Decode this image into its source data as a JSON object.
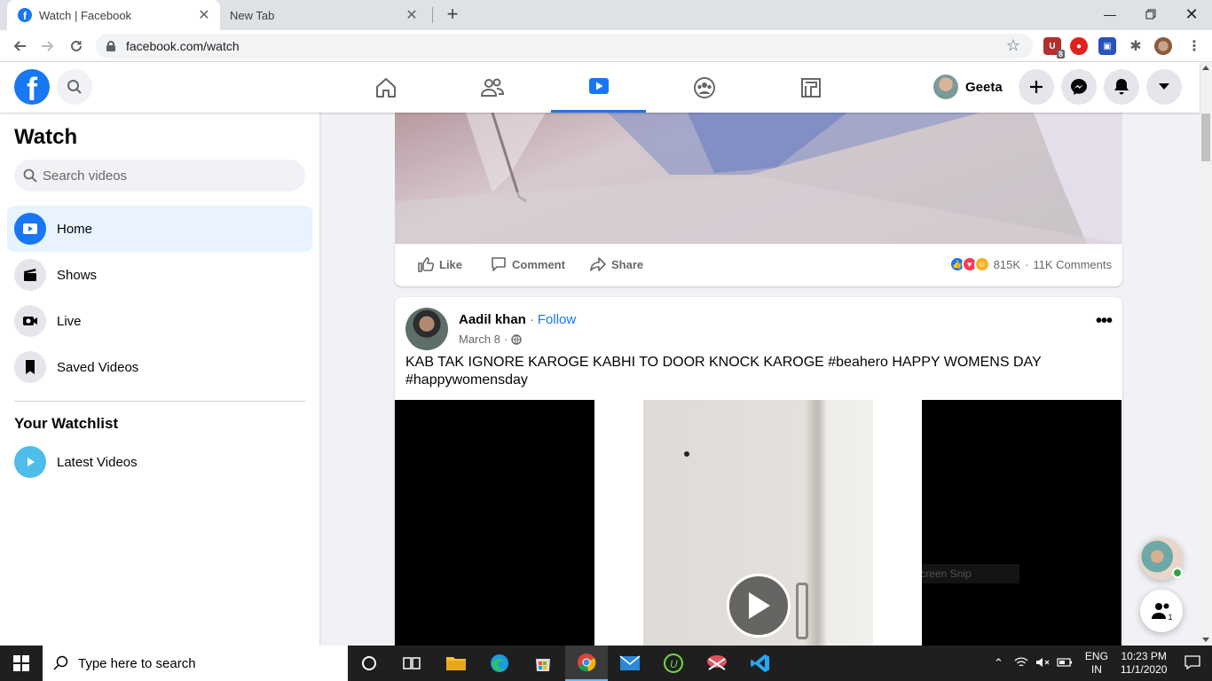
{
  "browser": {
    "tabs": [
      {
        "title": "Watch | Facebook",
        "active": true
      },
      {
        "title": "New Tab",
        "active": false
      }
    ],
    "url": "facebook.com/watch",
    "extension_badge": "8"
  },
  "header": {
    "logo_letter": "f",
    "profile_name": "Geeta"
  },
  "sidebar": {
    "title": "Watch",
    "search_placeholder": "Search videos",
    "items": [
      {
        "label": "Home",
        "icon": "play-icon"
      },
      {
        "label": "Shows",
        "icon": "clapperboard-icon"
      },
      {
        "label": "Live",
        "icon": "live-camera-icon"
      },
      {
        "label": "Saved Videos",
        "icon": "bookmark-icon"
      }
    ],
    "watchlist_title": "Your Watchlist",
    "watchlist_items": [
      {
        "label": "Latest Videos",
        "icon": "play-icon"
      }
    ]
  },
  "post1": {
    "actions": {
      "like": "Like",
      "comment": "Comment",
      "share": "Share"
    },
    "reaction_count": "815K",
    "separator": "·",
    "comments_count": "11K Comments"
  },
  "post2": {
    "author": "Aadil khan",
    "separator": "·",
    "follow_label": "Follow",
    "date": "March 8",
    "date_separator": "·",
    "caption": "KAB TAK IGNORE KAROGE KABHI TO DOOR KNOCK KAROGE #beahero HAPPY WOMENS DAY #happywomensday",
    "overlay_hint": "Full-screen Snip"
  },
  "floating": {
    "people_badge": "1"
  },
  "taskbar": {
    "search_placeholder": "Type here to search",
    "language": "ENG",
    "region": "IN",
    "time": "10:23 PM",
    "date": "11/1/2020"
  },
  "colors": {
    "facebook_blue": "#1877f2",
    "active_bg": "#e7f3ff",
    "taskbar": "#1f1f1f"
  }
}
